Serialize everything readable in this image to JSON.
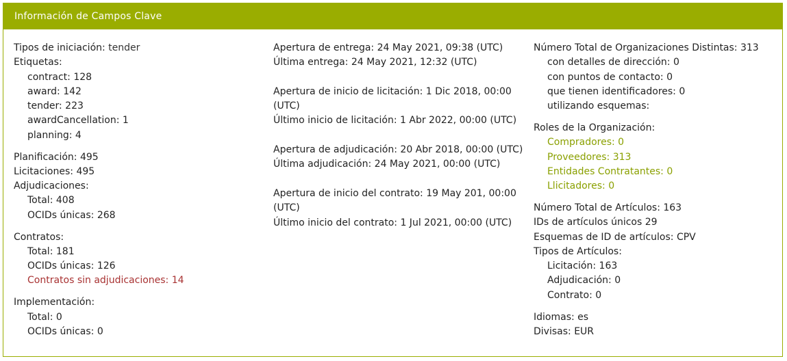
{
  "header": {
    "title": "Información de Campos Clave"
  },
  "col1": {
    "initiation_label": "Tipos de iniciación:",
    "initiation_value": "tender",
    "tags_label": "Etiquetas:",
    "tags": [
      {
        "label": "contract:",
        "value": "128"
      },
      {
        "label": "award:",
        "value": "142"
      },
      {
        "label": "tender:",
        "value": "223"
      },
      {
        "label": "awardCancellation:",
        "value": "1"
      },
      {
        "label": "planning:",
        "value": "4"
      }
    ],
    "planning_label": "Planificación:",
    "planning_value": "495",
    "tenders_label": "Licitaciones:",
    "tenders_value": "495",
    "awards_label": "Adjudicaciones:",
    "awards_total_label": "Total:",
    "awards_total_value": "408",
    "awards_ocids_label": "OCIDs únicas:",
    "awards_ocids_value": "268",
    "contracts_label": "Contratos:",
    "contracts_total_label": "Total:",
    "contracts_total_value": "181",
    "contracts_ocids_label": "OCIDs únicas:",
    "contracts_ocids_value": "126",
    "contracts_no_award": "Contratos sin adjudicaciones: 14",
    "impl_label": "Implementación:",
    "impl_total_label": "Total:",
    "impl_total_value": "0",
    "impl_ocids_label": "OCIDs únicas:",
    "impl_ocids_value": "0"
  },
  "col2": {
    "delivery_open_label": "Apertura de entrega:",
    "delivery_open_value": "24 May 2021, 09:38 (UTC)",
    "delivery_last_label": "Última entrega:",
    "delivery_last_value": "24 May 2021, 12:32 (UTC)",
    "tender_start_open_label": "Apertura de inicio de licitación:",
    "tender_start_open_value": "1 Dic 2018, 00:00 (UTC)",
    "tender_start_last_label": "Último inicio de licitación:",
    "tender_start_last_value": "1 Abr 2022, 00:00 (UTC)",
    "award_open_label": "Apertura de adjudicación:",
    "award_open_value": "20 Abr 2018, 00:00 (UTC)",
    "award_last_label": "Última adjudicación:",
    "award_last_value": "24 May 2021, 00:00 (UTC)",
    "contract_start_open_label": "Apertura de inicio del contrato:",
    "contract_start_open_value": "19 May 201, 00:00 (UTC)",
    "contract_start_last_label": "Último inicio del contrato:",
    "contract_start_last_value": "1 Jul 2021, 00:00 (UTC)"
  },
  "col3": {
    "orgs_label": "Número Total de Organizaciones Distintas:",
    "orgs_value": "313",
    "orgs_address_label": "con detalles de dirección:",
    "orgs_address_value": "0",
    "orgs_contact_label": "con puntos de contacto:",
    "orgs_contact_value": "0",
    "orgs_ids_label": "que tienen identificadores:",
    "orgs_ids_value": "0",
    "orgs_schemes_label": "utilizando esquemas:",
    "roles_label": "Roles de la Organización:",
    "roles": [
      "Compradores: 0",
      "Proveedores: 313",
      "Entidades Contratantes: 0",
      "Llicitadores: 0"
    ],
    "items_label": "Número Total de Artículos:",
    "items_value": "163",
    "item_ids_label": "IDs de artículos únicos",
    "item_ids_value": "29",
    "item_schemes_label": "Esquemas de ID de artículos:",
    "item_schemes_value": "CPV",
    "item_types_label": "Tipos de Artículos:",
    "item_tender_label": "Licitación:",
    "item_tender_value": "163",
    "item_award_label": "Adjudicación:",
    "item_award_value": "0",
    "item_contract_label": "Contrato:",
    "item_contract_value": "0",
    "languages_label": "Idiomas:",
    "languages_value": "es",
    "currencies_label": "Divisas:",
    "currencies_value": "EUR"
  }
}
